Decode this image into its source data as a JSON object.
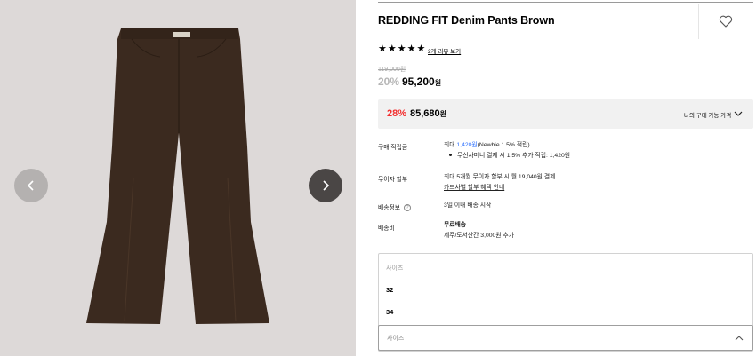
{
  "product": {
    "title": "REDDING FIT Denim Pants Brown",
    "review_link": "2개 리뷰 보기",
    "rating_stars": 5,
    "original_price": "119,000원",
    "discount_rate": "20%",
    "sale_price": "95,200",
    "sale_currency": "원"
  },
  "best_price": {
    "rate": "28%",
    "price": "85,680",
    "currency": "원",
    "my_price_label": "나의 구매 가능 가격"
  },
  "details": {
    "points_label": "구매 적립금",
    "points_prefix": "최대 ",
    "points_amount": "1,420원",
    "points_suffix": "(Newbie 1.5% 적립)",
    "points_sub": "무신사머니 결제 시 1.5% 추가 적립: 1,420원",
    "installment_label": "무이자 할부",
    "installment_text": "최대 5개월 무이자 할부 시 월 19,040원 결제",
    "installment_link": "카드사별 할부 혜택 안내",
    "shipping_label": "배송정보",
    "shipping_text": "3일 이내 배송 시작",
    "fee_label": "배송비",
    "fee_text": "무료배송",
    "fee_sub": "제주/도서산간 3,000원 추가"
  },
  "size": {
    "placeholder": "사이즈",
    "options": [
      "32",
      "34"
    ],
    "select_label": "사이즈"
  },
  "colors": {
    "accent_red": "#f22e2e",
    "accent_blue": "#2b6fff",
    "pants_brown": "#3b2a1f",
    "gallery_bg": "#ddd9d8"
  },
  "icons": [
    "chevron-left-icon",
    "chevron-right-icon",
    "heart-icon",
    "star-icon",
    "chevron-down-icon",
    "chevron-up-icon",
    "info-icon"
  ]
}
